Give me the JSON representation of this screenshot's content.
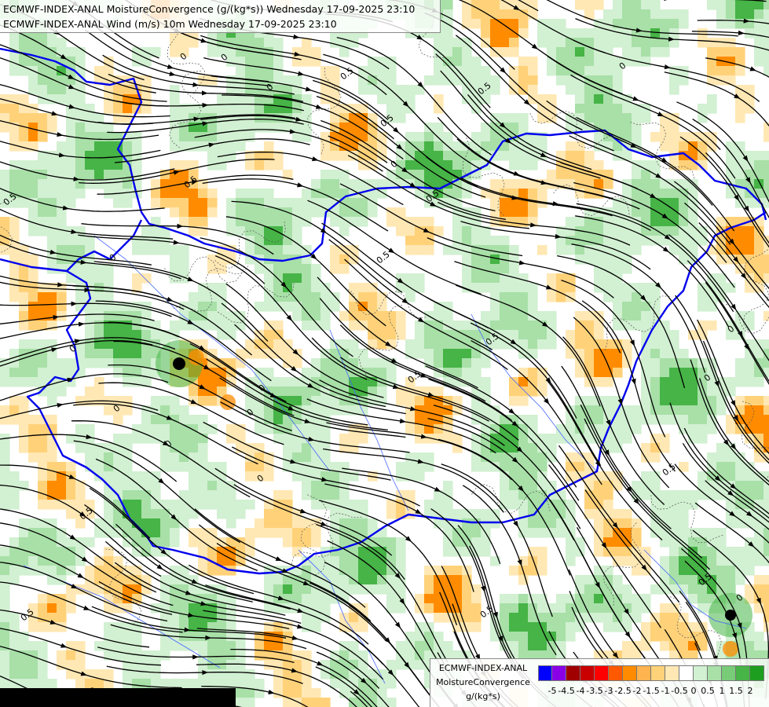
{
  "title": {
    "line1": "ECMWF-INDEX-ANAL MoistureConvergence (g/(kg*s)) Wednesday 17-09-2025 23:10",
    "line2": "ECMWF-INDEX-ANAL Wind (m/s) 10m Wednesday 17-09-2025 23:10"
  },
  "legend": {
    "line1": "ECMWF-INDEX-ANAL",
    "line2": "MoistureConvergence",
    "unit": "g/(kg*s)",
    "colors": [
      "#0000ff",
      "#8a00e6",
      "#a00000",
      "#c80000",
      "#ff0000",
      "#ff5a00",
      "#ff8c00",
      "#ffb450",
      "#ffd27a",
      "#ffe8b4",
      "#ffffff",
      "#d2f0d2",
      "#a8e0a8",
      "#78cc78",
      "#46b446",
      "#1e9e1e"
    ],
    "ticks": [
      "-5",
      "-4.5",
      "-4",
      "-3.5",
      "-3",
      "-2.5",
      "-2",
      "-1.5",
      "-1",
      "-0.5",
      "0",
      "0.5",
      "1",
      "1.5",
      "2"
    ]
  },
  "contour_labels": [
    "0",
    "0.5"
  ],
  "colors": {
    "border": "#0000ee",
    "river": "#4466ff",
    "streamline": "#000000",
    "convergence_light": "#d2f0d2",
    "convergence_mid": "#a8e0a8",
    "convergence_strong": "#46b446",
    "divergence_light": "#ffe8b4",
    "divergence_mid": "#ffd27a",
    "divergence_strong": "#ff8c00",
    "background": "#ffffff"
  }
}
